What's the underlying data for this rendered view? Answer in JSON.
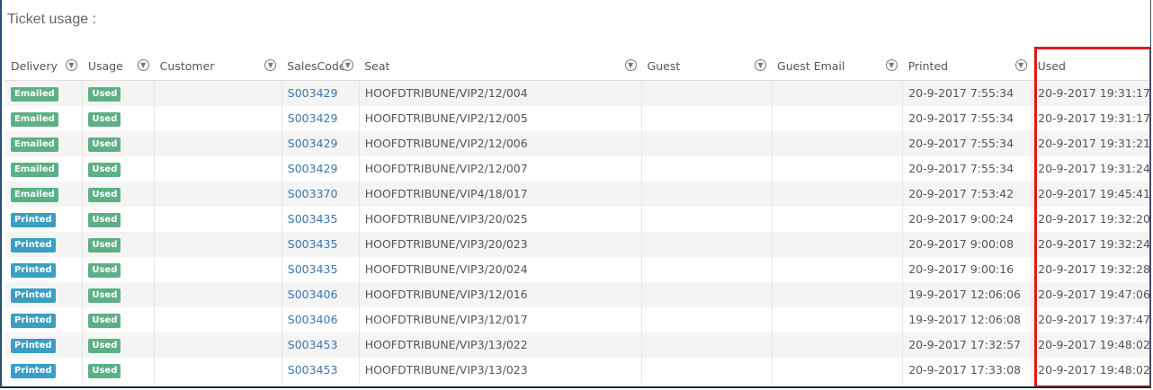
{
  "title": "Ticket usage :",
  "columns": [
    "Delivery",
    "Usage",
    "Customer",
    "SalesCode",
    "Seat",
    "Guest",
    "Guest Email",
    "Printed",
    "Used"
  ],
  "rows": [
    {
      "delivery": "Emailed",
      "delivery_color": "#5cb085",
      "usage": "Used",
      "customer": "",
      "salescode": "S003429",
      "seat": "HOOFDTRIBUNE/VIP2/12/004",
      "guest": "",
      "guest_email": "",
      "printed": "20-9-2017 7:55:34",
      "used": "20-9-2017 19:31:17"
    },
    {
      "delivery": "Emailed",
      "delivery_color": "#5cb085",
      "usage": "Used",
      "customer": "",
      "salescode": "S003429",
      "seat": "HOOFDTRIBUNE/VIP2/12/005",
      "guest": "",
      "guest_email": "",
      "printed": "20-9-2017 7:55:34",
      "used": "20-9-2017 19:31:17"
    },
    {
      "delivery": "Emailed",
      "delivery_color": "#5cb085",
      "usage": "Used",
      "customer": "",
      "salescode": "S003429",
      "seat": "HOOFDTRIBUNE/VIP2/12/006",
      "guest": "",
      "guest_email": "",
      "printed": "20-9-2017 7:55:34",
      "used": "20-9-2017 19:31:21"
    },
    {
      "delivery": "Emailed",
      "delivery_color": "#5cb085",
      "usage": "Used",
      "customer": "",
      "salescode": "S003429",
      "seat": "HOOFDTRIBUNE/VIP2/12/007",
      "guest": "",
      "guest_email": "",
      "printed": "20-9-2017 7:55:34",
      "used": "20-9-2017 19:31:24"
    },
    {
      "delivery": "Emailed",
      "delivery_color": "#5cb085",
      "usage": "Used",
      "customer": "",
      "salescode": "S003370",
      "seat": "HOOFDTRIBUNE/VIP4/18/017",
      "guest": "",
      "guest_email": "",
      "printed": "20-9-2017 7:53:42",
      "used": "20-9-2017 19:45:41"
    },
    {
      "delivery": "Printed",
      "delivery_color": "#3a9fc3",
      "usage": "Used",
      "customer": "",
      "salescode": "S003435",
      "seat": "HOOFDTRIBUNE/VIP3/20/025",
      "guest": "",
      "guest_email": "",
      "printed": "20-9-2017 9:00:24",
      "used": "20-9-2017 19:32:20"
    },
    {
      "delivery": "Printed",
      "delivery_color": "#3a9fc3",
      "usage": "Used",
      "customer": "",
      "salescode": "S003435",
      "seat": "HOOFDTRIBUNE/VIP3/20/023",
      "guest": "",
      "guest_email": "",
      "printed": "20-9-2017 9:00:08",
      "used": "20-9-2017 19:32:24"
    },
    {
      "delivery": "Printed",
      "delivery_color": "#3a9fc3",
      "usage": "Used",
      "customer": "",
      "salescode": "S003435",
      "seat": "HOOFDTRIBUNE/VIP3/20/024",
      "guest": "",
      "guest_email": "",
      "printed": "20-9-2017 9:00:16",
      "used": "20-9-2017 19:32:28"
    },
    {
      "delivery": "Printed",
      "delivery_color": "#3a9fc3",
      "usage": "Used",
      "customer": "",
      "salescode": "S003406",
      "seat": "HOOFDTRIBUNE/VIP3/12/016",
      "guest": "",
      "guest_email": "",
      "printed": "19-9-2017 12:06:06",
      "used": "20-9-2017 19:47:06"
    },
    {
      "delivery": "Printed",
      "delivery_color": "#3a9fc3",
      "usage": "Used",
      "customer": "",
      "salescode": "S003406",
      "seat": "HOOFDTRIBUNE/VIP3/12/017",
      "guest": "",
      "guest_email": "",
      "printed": "19-9-2017 12:06:08",
      "used": "20-9-2017 19:37:47"
    },
    {
      "delivery": "Printed",
      "delivery_color": "#3a9fc3",
      "usage": "Used",
      "customer": "",
      "salescode": "S003453",
      "seat": "HOOFDTRIBUNE/VIP3/13/022",
      "guest": "",
      "guest_email": "",
      "printed": "20-9-2017 17:32:57",
      "used": "20-9-2017 19:48:02"
    },
    {
      "delivery": "Printed",
      "delivery_color": "#3a9fc3",
      "usage": "Used",
      "customer": "",
      "salescode": "S003453",
      "seat": "HOOFDTRIBUNE/VIP3/13/023",
      "guest": "",
      "guest_email": "",
      "printed": "20-9-2017 17:33:08",
      "used": "20-9-2017 19:48:02"
    }
  ],
  "usage_color": "#5cb085",
  "highlight_color": "#e0161a",
  "highlighted_column": "Used",
  "filter_icon": "filter-icon"
}
